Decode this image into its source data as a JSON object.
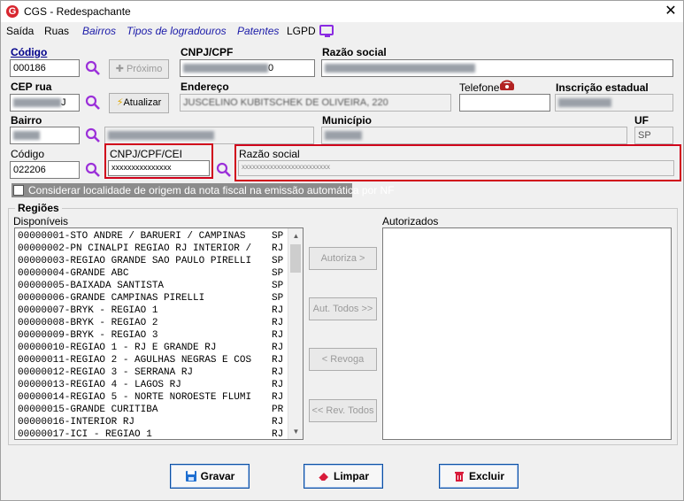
{
  "window": {
    "title": "CGS - Redespachante",
    "close": "✕",
    "app_icon": "G"
  },
  "menu": [
    "Saída",
    "Ruas",
    "Bairros",
    "Tipos de logradouros",
    "Patentes",
    "LGPD"
  ],
  "labels": {
    "codigo": "Código",
    "cnpj_cpf": "CNPJ/CPF",
    "razao_social": "Razão social",
    "cep_rua": "CEP rua",
    "endereco": "Endereço",
    "telefone": "Telefone",
    "inscricao_estadual": "Inscrição estadual",
    "bairro": "Bairro",
    "municipio": "Município",
    "uf": "UF",
    "codigo2": "Código",
    "cnpj_cpf_cei": "CNPJ/CPF/CEI",
    "razao_social2": "Razão social"
  },
  "values": {
    "codigo": "000186",
    "cnpj_tail": "0",
    "cep_tail": "J",
    "endereco": "JUSCELINO KUBITSCHEK DE OLIVEIRA, 220",
    "uf": "SP",
    "codigo2": "022206",
    "cnpj_cpf_cei": "xxxxxxxxxxxxxxx",
    "razao_social2": "xxxxxxxxxxxxxxxxxxxxxxxxx"
  },
  "buttons": {
    "proximo": "Próximo",
    "atualizar": "Atualizar",
    "autoriza": "Autoriza >",
    "aut_todos": "Aut. Todos >>",
    "revoga": "< Revoga",
    "rev_todos": "<< Rev. Todos",
    "gravar": "Gravar",
    "limpar": "Limpar",
    "excluir": "Excluir"
  },
  "checkbox": {
    "label": "Considerar localidade de origem da nota fiscal na emissão automática por NF",
    "checked": false
  },
  "regioes": {
    "title": "Regiões",
    "disponiveis_label": "Disponíveis",
    "autorizados_label": "Autorizados",
    "disponiveis": [
      {
        "text": "00000001-STO ANDRE / BARUERI / CAMPINAS",
        "uf": "SP"
      },
      {
        "text": "00000002-PN CINALPI REGIAO RJ INTERIOR /",
        "uf": "RJ"
      },
      {
        "text": "00000003-REGIAO GRANDE SAO PAULO PIRELLI",
        "uf": "SP"
      },
      {
        "text": "00000004-GRANDE ABC",
        "uf": "SP"
      },
      {
        "text": "00000005-BAIXADA SANTISTA",
        "uf": "SP"
      },
      {
        "text": "00000006-GRANDE CAMPINAS PIRELLI",
        "uf": "SP"
      },
      {
        "text": "00000007-BRYK - REGIAO 1",
        "uf": "RJ"
      },
      {
        "text": "00000008-BRYK - REGIAO 2",
        "uf": "RJ"
      },
      {
        "text": "00000009-BRYK - REGIAO 3",
        "uf": "RJ"
      },
      {
        "text": "00000010-REGIAO 1 - RJ E GRANDE RJ",
        "uf": "RJ"
      },
      {
        "text": "00000011-REGIAO 2 - AGULHAS NEGRAS E COS",
        "uf": "RJ"
      },
      {
        "text": "00000012-REGIAO 3 - SERRANA RJ",
        "uf": "RJ"
      },
      {
        "text": "00000013-REGIAO 4 - LAGOS RJ",
        "uf": "RJ"
      },
      {
        "text": "00000014-REGIAO 5 - NORTE NOROESTE FLUMI",
        "uf": "RJ"
      },
      {
        "text": "00000015-GRANDE CURITIBA",
        "uf": "PR"
      },
      {
        "text": "00000016-INTERIOR RJ",
        "uf": "RJ"
      },
      {
        "text": "00000017-ICI - REGIAO 1",
        "uf": "RJ"
      }
    ],
    "autorizados": []
  },
  "colors": {
    "highlight_border": "#d0021b",
    "menu_link": "#1a1aa8",
    "button_border": "#0b4ea2"
  },
  "icons": {
    "search": "search-icon",
    "phone": "phone-icon",
    "monitor": "monitor-icon"
  }
}
